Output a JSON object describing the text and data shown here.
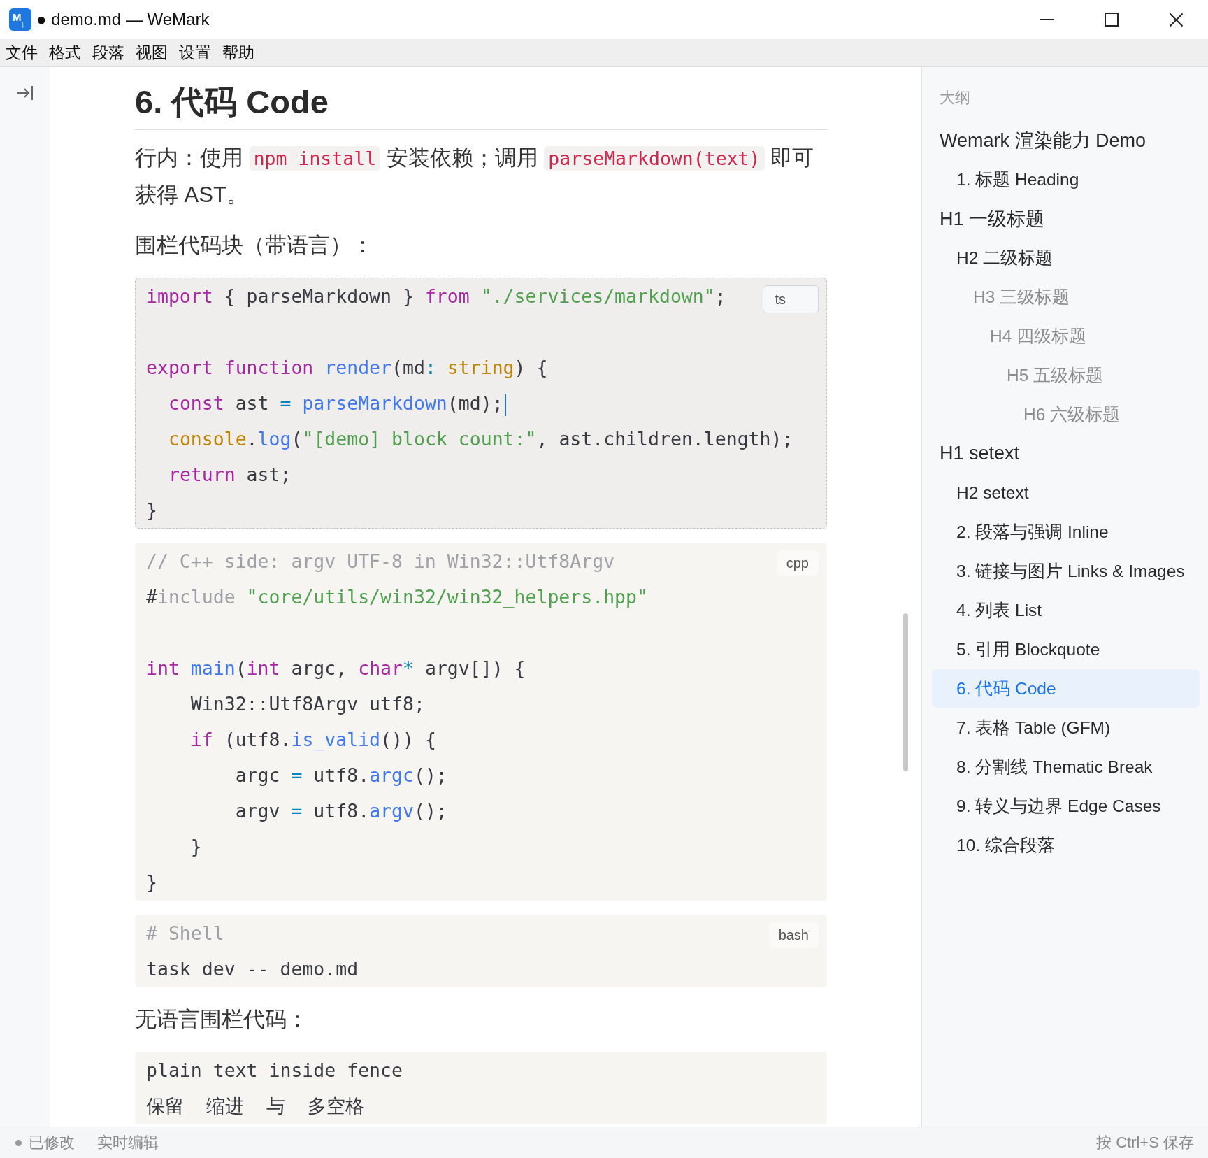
{
  "window": {
    "logo": "M$_{↓}$",
    "title": "● demo.md — WeMark"
  },
  "menu": [
    "文件",
    "格式",
    "段落",
    "视图",
    "设置",
    "帮助"
  ],
  "document": {
    "heading": "6. 代码 Code",
    "blocks": [
      {
        "kind": "paragraph",
        "runs": [
          {
            "kind": "text",
            "text": "行内：使用 "
          },
          {
            "kind": "code",
            "text": "npm install"
          },
          {
            "kind": "text",
            "text": " 安装依赖；调用 "
          },
          {
            "kind": "code",
            "text": "parseMarkdown(text)"
          },
          {
            "kind": "text",
            "text": " 即可获得 AST。"
          }
        ]
      },
      {
        "kind": "paragraph",
        "runs": [
          {
            "kind": "text",
            "text": "围栏代码块（带语言）："
          }
        ]
      },
      {
        "kind": "code",
        "language": "ts",
        "active": true,
        "lines": [
          {
            "kind": "code",
            "tokens": [
              {
                "kind": "keyword",
                "text": "import"
              },
              {
                "kind": "plain",
                "text": " { parseMarkdown } "
              },
              {
                "kind": "keyword",
                "text": "from"
              },
              {
                "kind": "string",
                "text": " \"./services/markdown\""
              },
              {
                "kind": "plain",
                "text": ";"
              }
            ]
          },
          {
            "kind": "blank"
          },
          {
            "kind": "code",
            "tokens": [
              {
                "kind": "keyword",
                "text": "export"
              },
              {
                "kind": "keyword",
                "text": " function"
              },
              {
                "kind": "function",
                "text": " render"
              },
              {
                "kind": "plain",
                "text": "(md"
              },
              {
                "kind": "operator",
                "text": ":"
              },
              {
                "kind": "type",
                "text": " string"
              },
              {
                "kind": "plain",
                "text": ") {"
              }
            ]
          },
          {
            "kind": "code",
            "tokens": [
              {
                "kind": "keyword",
                "text": "  const"
              },
              {
                "kind": "plain",
                "text": " ast "
              },
              {
                "kind": "operator",
                "text": "="
              },
              {
                "kind": "function",
                "text": " parseMarkdown"
              },
              {
                "kind": "plain",
                "text": "(md);"
              },
              {
                "kind": "cursor"
              }
            ]
          },
          {
            "kind": "code",
            "tokens": [
              {
                "kind": "type",
                "text": "  console"
              },
              {
                "kind": "plain",
                "text": "."
              },
              {
                "kind": "function",
                "text": "log"
              },
              {
                "kind": "plain",
                "text": "("
              },
              {
                "kind": "string",
                "text": "\"[demo] block count:\""
              },
              {
                "kind": "plain",
                "text": ", ast.children.length);"
              }
            ]
          },
          {
            "kind": "code",
            "tokens": [
              {
                "kind": "keyword",
                "text": "  return"
              },
              {
                "kind": "plain",
                "text": " ast;"
              }
            ]
          },
          {
            "kind": "code",
            "tokens": [
              {
                "kind": "plain",
                "text": "}"
              }
            ]
          }
        ]
      },
      {
        "kind": "code",
        "language": "cpp",
        "active": false,
        "lines": [
          {
            "kind": "code",
            "tokens": [
              {
                "kind": "comment",
                "text": "// C++ side: argv UTF-8 in Win32::Utf8Argv"
              }
            ]
          },
          {
            "kind": "code",
            "tokens": [
              {
                "kind": "plain",
                "text": "#"
              },
              {
                "kind": "meta",
                "text": "include"
              },
              {
                "kind": "string",
                "text": " \"core/utils/win32/win32_helpers.hpp\""
              }
            ]
          },
          {
            "kind": "blank"
          },
          {
            "kind": "code",
            "tokens": [
              {
                "kind": "keyword",
                "text": "int"
              },
              {
                "kind": "function",
                "text": " main"
              },
              {
                "kind": "plain",
                "text": "("
              },
              {
                "kind": "keyword",
                "text": "int"
              },
              {
                "kind": "plain",
                "text": " argc, "
              },
              {
                "kind": "keyword",
                "text": "char"
              },
              {
                "kind": "operator",
                "text": "*"
              },
              {
                "kind": "plain",
                "text": " argv[]) {"
              }
            ]
          },
          {
            "kind": "code",
            "tokens": [
              {
                "kind": "plain",
                "text": "    Win32::Utf8Argv utf8;"
              }
            ]
          },
          {
            "kind": "code",
            "tokens": [
              {
                "kind": "keyword",
                "text": "    if"
              },
              {
                "kind": "plain",
                "text": " (utf8."
              },
              {
                "kind": "function",
                "text": "is_valid"
              },
              {
                "kind": "plain",
                "text": "()) {"
              }
            ]
          },
          {
            "kind": "code",
            "tokens": [
              {
                "kind": "plain",
                "text": "        argc "
              },
              {
                "kind": "operator",
                "text": "="
              },
              {
                "kind": "plain",
                "text": " utf8."
              },
              {
                "kind": "function",
                "text": "argc"
              },
              {
                "kind": "plain",
                "text": "();"
              }
            ]
          },
          {
            "kind": "code",
            "tokens": [
              {
                "kind": "plain",
                "text": "        argv "
              },
              {
                "kind": "operator",
                "text": "="
              },
              {
                "kind": "plain",
                "text": " utf8."
              },
              {
                "kind": "function",
                "text": "argv"
              },
              {
                "kind": "plain",
                "text": "();"
              }
            ]
          },
          {
            "kind": "code",
            "tokens": [
              {
                "kind": "plain",
                "text": "    }"
              }
            ]
          },
          {
            "kind": "code",
            "tokens": [
              {
                "kind": "plain",
                "text": "}"
              }
            ]
          }
        ]
      },
      {
        "kind": "code",
        "language": "bash",
        "active": false,
        "lines": [
          {
            "kind": "code",
            "tokens": [
              {
                "kind": "comment",
                "text": "# Shell"
              }
            ]
          },
          {
            "kind": "code",
            "tokens": [
              {
                "kind": "plain",
                "text": "task dev -- demo.md"
              }
            ]
          }
        ]
      },
      {
        "kind": "paragraph",
        "runs": [
          {
            "kind": "text",
            "text": "无语言围栏代码："
          }
        ]
      },
      {
        "kind": "code",
        "active": false,
        "lines": [
          {
            "kind": "code",
            "tokens": [
              {
                "kind": "plain",
                "text": "plain text inside fence"
              }
            ]
          },
          {
            "kind": "code",
            "tokens": [
              {
                "kind": "plain",
                "text": "保留  缩进  与  多空格"
              }
            ]
          }
        ]
      }
    ]
  },
  "outline": {
    "title": "大纲",
    "items": [
      {
        "label": "Wemark 渲染能力 Demo",
        "selected": false,
        "children": [
          {
            "label": "1. 标题 Heading",
            "selected": false
          }
        ]
      },
      {
        "label": "H1 一级标题",
        "selected": false,
        "children": [
          {
            "label": "H2 二级标题",
            "selected": false,
            "children": [
              {
                "label": "H3 三级标题",
                "selected": false,
                "children": [
                  {
                    "label": "H4 四级标题",
                    "selected": false,
                    "children": [
                      {
                        "label": "H5 五级标题",
                        "selected": false,
                        "children": [
                          {
                            "label": "H6 六级标题",
                            "selected": false
                          }
                        ]
                      }
                    ]
                  }
                ]
              }
            ]
          }
        ]
      },
      {
        "label": "H1 setext",
        "selected": false,
        "children": [
          {
            "label": "H2 setext",
            "selected": false
          },
          {
            "label": "2. 段落与强调 Inline",
            "selected": false
          },
          {
            "label": "3. 链接与图片 Links & Images",
            "selected": false
          },
          {
            "label": "4. 列表 List",
            "selected": false
          },
          {
            "label": "5. 引用 Blockquote",
            "selected": false
          },
          {
            "label": "6. 代码 Code",
            "selected": true
          },
          {
            "label": "7. 表格 Table (GFM)",
            "selected": false
          },
          {
            "label": "8. 分割线 Thematic Break",
            "selected": false
          },
          {
            "label": "9. 转义与边界 Edge Cases",
            "selected": false
          },
          {
            "label": "10. 综合段落",
            "selected": false
          }
        ]
      }
    ]
  },
  "status_bar": {
    "modified": "已修改",
    "mode": "实时编辑",
    "hint": "按 Ctrl+S 保存"
  }
}
